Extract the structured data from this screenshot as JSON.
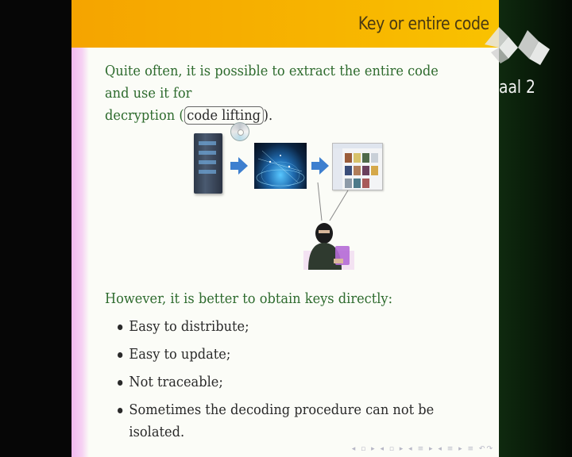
{
  "slide": {
    "title": "Key or entire code",
    "intro_part1": "Quite often, it is possible to extract the entire code and use it for",
    "intro_part2": "decryption (",
    "intro_boxed": "code lifting",
    "intro_part3": ").",
    "however": "However, it is better to obtain keys directly:",
    "bullets": [
      "Easy to distribute;",
      "Easy to update;",
      "Not traceable;",
      "Sometimes the decoding procedure can not be isolated."
    ]
  },
  "diagram": {
    "icons": [
      "server-icon",
      "disc-icon",
      "arrow-right-icon",
      "globe-network-icon",
      "arrow-right-icon",
      "app-screenshot-icon",
      "hacker-icon"
    ]
  },
  "channel": {
    "logo": "broadcaster-logo-icon",
    "text": "aal 2"
  },
  "colors": {
    "header": "#f7b400",
    "title_text": "#4a3a12",
    "green_text": "#2e6b2e",
    "arrow": "#3d7fcf",
    "stripe": "#f1b8ee"
  }
}
